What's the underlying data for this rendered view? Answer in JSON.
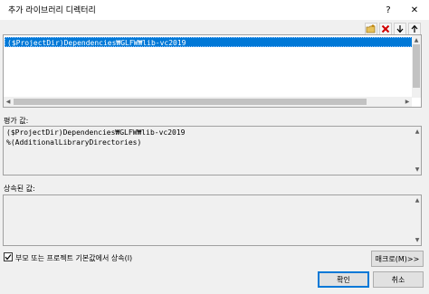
{
  "window": {
    "title": "추가 라이브러리 디렉터리",
    "help_label": "?",
    "close_label": "✕"
  },
  "toolbar": {
    "new_folder_icon": "new-folder-icon",
    "delete_icon": "delete-icon",
    "move_down_icon": "move-down-icon",
    "move_up_icon": "move-up-icon"
  },
  "list": {
    "items": [
      "($ProjectDir)Dependencies₩GLFW₩lib-vc2019"
    ]
  },
  "evaluated": {
    "label": "평가 값:",
    "lines": [
      "($ProjectDir)Dependencies₩GLFW₩lib-vc2019",
      "%(AdditionalLibraryDirectories)"
    ]
  },
  "inherited": {
    "label": "상속된 값:"
  },
  "inherit_checkbox": {
    "label": "부모 또는 프로젝트 기본값에서 상속(I)",
    "checked": true
  },
  "buttons": {
    "macro": "매크로(M)>>",
    "ok": "확인",
    "cancel": "취소"
  },
  "colors": {
    "selection": "#0078d7",
    "background": "#f0f0f0",
    "delete_red": "#d00000"
  }
}
